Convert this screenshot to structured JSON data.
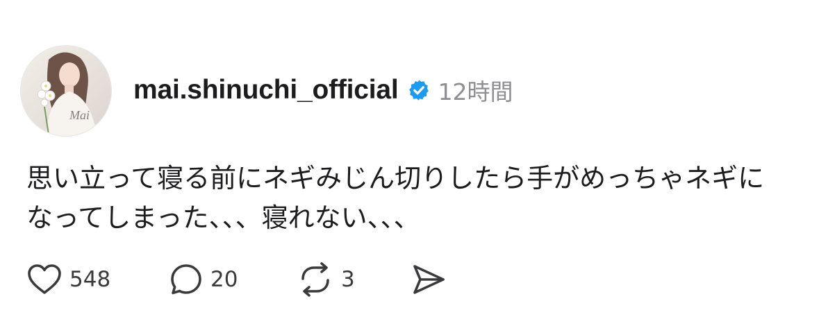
{
  "post": {
    "username": "mai.shinuchi_official",
    "verified": true,
    "timestamp": "12時間",
    "text": "思い立って寝る前にネギみじん切りしたら手がめっちゃネギに\nなってしまった、、、寝れない、、、",
    "avatar": {
      "signature": "Mai"
    }
  },
  "actions": {
    "like_icon": "heart-icon",
    "like_count": "548",
    "reply_icon": "comment-icon",
    "reply_count": "20",
    "repost_icon": "repost-icon",
    "repost_count": "3",
    "share_icon": "send-icon"
  },
  "colors": {
    "verified_badge": "#1d9bf0",
    "muted_text": "#8e8e93",
    "primary_text": "#1c1c1e"
  }
}
